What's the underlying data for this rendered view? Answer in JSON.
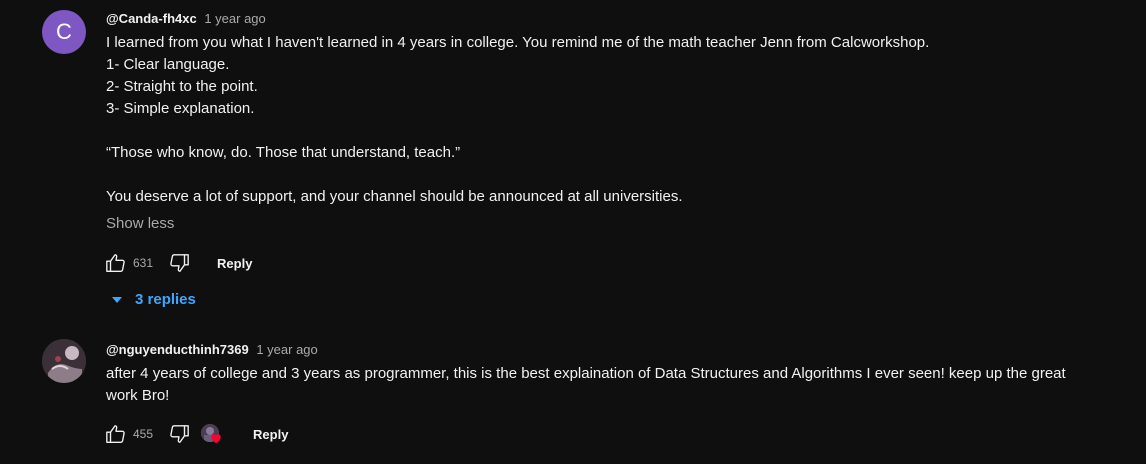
{
  "comments": [
    {
      "avatar_letter": "C",
      "avatar_color": "#7e57c2",
      "author": "@Canda-fh4xc",
      "time": "1 year ago",
      "lines": [
        "I learned from you what I haven't learned in 4 years in college. You remind me of the math teacher Jenn from Calcworkshop.",
        "1- Clear language.",
        "2- Straight to the point.",
        "3- Simple explanation.",
        "",
        "“Those who know, do. Those that understand, teach.”",
        "",
        "You deserve a lot of support, and your channel should be announced at all universities."
      ],
      "show_less": "Show less",
      "likes": "631",
      "reply_label": "Reply",
      "replies_label": "3 replies"
    },
    {
      "avatar_icon": "profile-photo",
      "author": "@nguyenducthinh7369",
      "time": "1 year ago",
      "lines": [
        "after 4 years of college and 3 years as programmer, this is the best explaination of Data Structures and Algorithms I ever seen! keep up the great",
        "work Bro!"
      ],
      "likes": "455",
      "reply_label": "Reply",
      "creator_heart": true
    }
  ],
  "colors": {
    "background": "#0f0f0f",
    "link": "#3ea6ff",
    "heart": "#ff0033"
  }
}
